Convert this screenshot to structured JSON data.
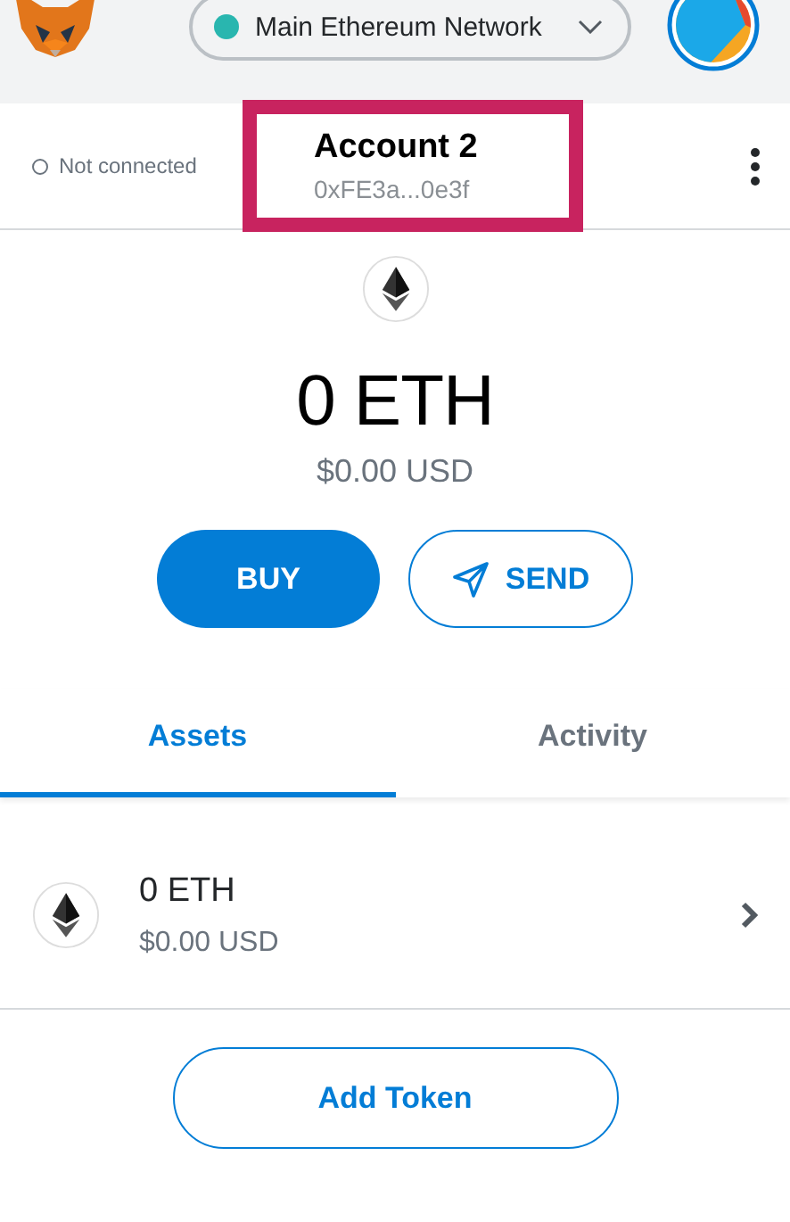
{
  "header": {
    "network": {
      "label": "Main Ethereum Network"
    }
  },
  "account_bar": {
    "connection": {
      "label": "Not connected",
      "connected": false
    },
    "account": {
      "name": "Account 2",
      "address": "0xFE3a...0e3f",
      "highlighted": true
    }
  },
  "balance": {
    "amount": "0 ETH",
    "fiat": "$0.00 USD"
  },
  "actions": [
    {
      "label": "BUY",
      "kind": "primary"
    },
    {
      "label": "SEND",
      "kind": "send"
    }
  ],
  "tabs": [
    {
      "label": "Assets",
      "selected": true
    },
    {
      "label": "Activity",
      "selected": false
    }
  ],
  "assets": [
    {
      "amount": "0 ETH",
      "fiat": "$0.00 USD"
    }
  ],
  "add_token": {
    "label": "Add Token"
  }
}
